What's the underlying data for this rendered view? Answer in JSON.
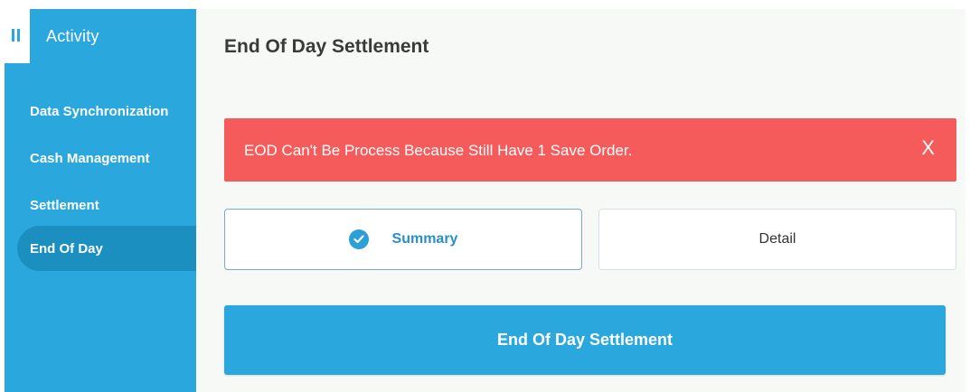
{
  "sidebar": {
    "title": "Activity",
    "menu_icon": "hamburger-icon",
    "items": [
      {
        "label": "Data Synchronization",
        "active": false
      },
      {
        "label": "Cash Management",
        "active": false
      },
      {
        "label": "Settlement",
        "active": false
      },
      {
        "label": "End Of Day",
        "active": true
      }
    ]
  },
  "main": {
    "title": "End Of Day Settlement",
    "alert": {
      "message": "EOD Can't Be Process Because Still Have 1 Save Order.",
      "close_label": "X"
    },
    "tabs": [
      {
        "label": "Summary",
        "selected": true,
        "icon": "check-circle-icon"
      },
      {
        "label": "Detail",
        "selected": false
      }
    ],
    "action_button": "End Of Day Settlement"
  },
  "colors": {
    "sidebar_bg": "#2aa7dc",
    "sidebar_active": "#1a8fc0",
    "alert_bg": "#f55b5b",
    "accent": "#2a9fd8",
    "main_bg": "#f7f9f6"
  }
}
